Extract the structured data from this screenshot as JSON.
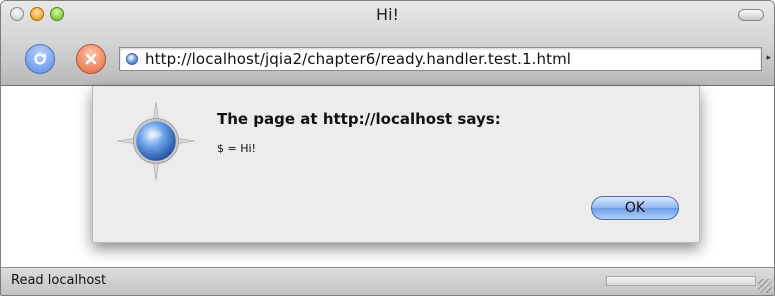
{
  "window": {
    "title": "Hi!"
  },
  "toolbar": {
    "address": "http://localhost/jqia2/chapter6/ready.handler.test.1.html",
    "reload_icon": "reload-icon",
    "stop_icon": "stop-icon",
    "page_icon": "globe-icon"
  },
  "dialog": {
    "heading": "The page at http://localhost says:",
    "message": "$ = Hi!",
    "ok_label": "OK",
    "icon": "safari-compass-icon"
  },
  "status_bar": {
    "text": "Read localhost"
  },
  "colors": {
    "accent": "#6f9ee6",
    "background": "#ececec"
  }
}
